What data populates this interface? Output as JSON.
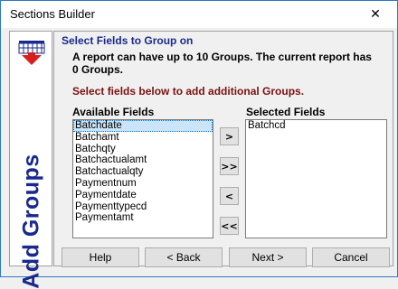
{
  "window": {
    "title": "Sections Builder",
    "close_glyph": "✕"
  },
  "side": {
    "text": "Add Groups",
    "icon": "table-with-red-arrow-icon"
  },
  "content": {
    "heading": "Select Fields to Group on",
    "info": "A report can have up to 10 Groups. The current report has 0 Groups.",
    "instruction": "Select fields below to add additional Groups."
  },
  "available": {
    "label": "Available Fields",
    "items": [
      "Batchdate",
      "Batchamt",
      "Batchqty",
      "Batchactualamt",
      "Batchactualqty",
      "Paymentnum",
      "Paymentdate",
      "Paymenttypecd",
      "Paymentamt"
    ],
    "selected_index": 0
  },
  "selected": {
    "label": "Selected Fields",
    "items": [
      "Batchcd"
    ]
  },
  "move_buttons": {
    "add": ">",
    "add_all": ">>",
    "remove": "<",
    "remove_all": "<<"
  },
  "buttons": {
    "help": "Help",
    "back": "< Back",
    "next": "Next >",
    "cancel": "Cancel"
  }
}
